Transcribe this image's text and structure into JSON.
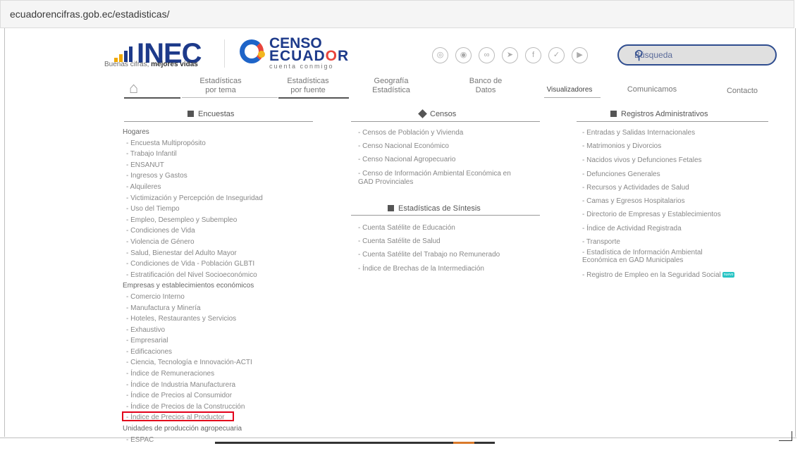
{
  "browser": {
    "url": "ecuadorencifras.gob.ec/estadisticas/"
  },
  "header": {
    "inec_logo": {
      "word": "INEC",
      "tagline_a": "Buenas cifras, ",
      "tagline_b": "mejores vidas"
    },
    "censo_logo": {
      "line1": "CENSO",
      "line2_a": "ECUAD",
      "line2_b": "O",
      "line2_c": "R",
      "line3": "cuenta conmigo"
    },
    "social_icons": [
      "instagram-icon",
      "telegram-icon",
      "flickr-icon",
      "send-icon",
      "facebook-icon",
      "twitter-icon",
      "youtube-icon"
    ],
    "search": {
      "placeholder": "Búsqueda"
    }
  },
  "nav": {
    "items": [
      {
        "line1": "Estadísticas",
        "line2": "por tema"
      },
      {
        "line1": "Estadísticas",
        "line2": "por fuente"
      },
      {
        "line1": "Geografía",
        "line2": "Estadística"
      },
      {
        "line1": "Banco de",
        "line2": "Datos"
      },
      {
        "line1": "Visualizadores",
        "line2": ""
      },
      {
        "line1": "Comunicamos",
        "line2": ""
      },
      {
        "line1": "Contacto",
        "line2": ""
      }
    ]
  },
  "columns": {
    "encuestas": {
      "title": "Encuestas",
      "rows": [
        {
          "text": "Hogares",
          "cat": true
        },
        {
          "text": "- Encuesta Multipropósito"
        },
        {
          "text": "- Trabajo Infantil"
        },
        {
          "text": "- ENSANUT"
        },
        {
          "text": "- Ingresos y Gastos"
        },
        {
          "text": "- Alquileres"
        },
        {
          "text": "- Victimización y Percepción de Inseguridad"
        },
        {
          "text": "- Uso del Tiempo"
        },
        {
          "text": "- Empleo, Desempleo y Subempleo"
        },
        {
          "text": "- Condiciones de Vida"
        },
        {
          "text": "- Violencia de Género"
        },
        {
          "text": "- Salud, Bienestar del Adulto Mayor"
        },
        {
          "text": "- Condiciones de Vida - Población GLBTI"
        },
        {
          "text": "- Estratificación del Nivel Socioeconómico"
        },
        {
          "text": "Empresas y establecimientos económicos",
          "cat": true
        },
        {
          "text": "- Comercio Interno"
        },
        {
          "text": "- Manufactura y Minería"
        },
        {
          "text": "- Hoteles, Restaurantes y Servicios"
        },
        {
          "text": "- Exhaustivo"
        },
        {
          "text": "- Empresarial"
        },
        {
          "text": "- Edificaciones"
        },
        {
          "text": "- Ciencia, Tecnología e Innovación-ACTI"
        },
        {
          "text": "- Índice de Remuneraciones"
        },
        {
          "text": "- Índice de Industria Manufacturera"
        },
        {
          "text": "- Índice de Precios al Consumidor"
        },
        {
          "text": "- Índice de Precios de la Construcción"
        },
        {
          "text": "- Índice de Precios al Productor"
        },
        {
          "text": "Unidades de producción agropecuaria",
          "cat": true
        },
        {
          "text": "- ESPAC"
        }
      ]
    },
    "censos": {
      "title": "Censos",
      "rows": [
        "- Censos de Población y Vivienda",
        "- Censo Nacional Económico",
        "- Censo Nacional Agropecuario",
        "- Censo de Información Ambiental Económica en",
        "GAD Provinciales"
      ]
    },
    "sintesis": {
      "title": "Estadísticas de Síntesis",
      "rows": [
        "- Cuenta Satélite de Educación",
        "- Cuenta Satélite de Salud",
        "- Cuenta Satélite del Trabajo no Remunerado",
        "- Índice de Brechas de la Intermediación"
      ]
    },
    "registros": {
      "title": "Registros Administrativos",
      "rows": [
        "- Entradas y Salidas Internacionales",
        "- Matrimonios y Divorcios",
        "- Nacidos vivos y Defunciones Fetales",
        "- Defunciones Generales",
        "- Recursos y Actividades de Salud",
        "- Camas y Egresos Hospitalarios",
        "- Directorio de Empresas y Establecimientos",
        "- Índice de Actividad Registrada",
        "- Transporte",
        "- Estadística de Información Ambiental",
        "Económica en GAD Municipales",
        "- Registro de Empleo en la Seguridad Social"
      ],
      "badge": "nuevo"
    }
  }
}
